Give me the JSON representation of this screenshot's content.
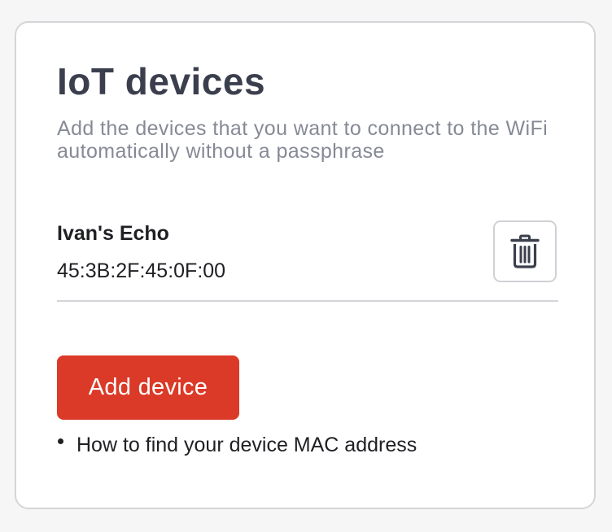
{
  "card": {
    "title": "IoT devices",
    "subtitle": "Add the devices that you want to connect to the WiFi automatically without a passphrase"
  },
  "devices": [
    {
      "name": "Ivan's Echo",
      "mac": "45:3B:2F:45:0F:00",
      "delete_icon": "trash-icon"
    }
  ],
  "actions": {
    "add_device_label": "Add device"
  },
  "help": {
    "links": [
      {
        "label": "How to find your device MAC address"
      }
    ]
  },
  "colors": {
    "page_background": "#f6f6f7",
    "card_background": "#ffffff",
    "border": "#d4d5d8",
    "title": "#3b3f4d",
    "subtitle": "#868a96",
    "text": "#1f1f24",
    "primary_button": "#db3a28",
    "primary_button_text": "#ffffff"
  }
}
